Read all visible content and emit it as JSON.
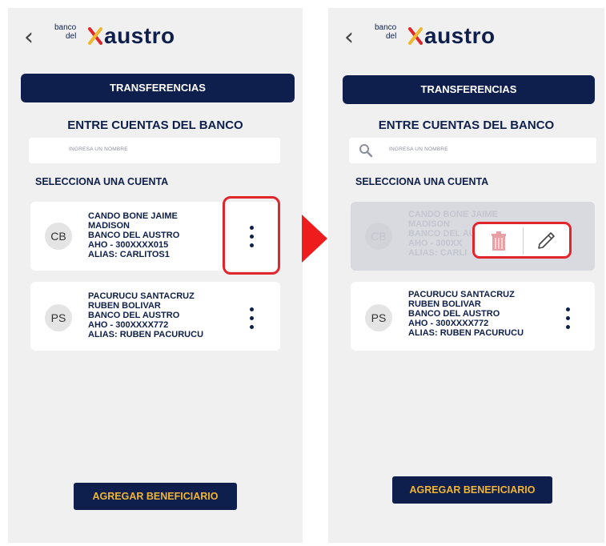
{
  "left": {
    "logo": {
      "small_top": "banco",
      "small_bottom": "del",
      "word": "austro"
    },
    "title_button": "TRANSFERENCIAS",
    "subtitle": "ENTRE CUENTAS DEL BANCO",
    "search_placeholder": "INGRESA UN NOMBRE",
    "select_heading": "SELECCIONA UNA CUENTA",
    "accounts": [
      {
        "initials": "CB",
        "lines": [
          "CANDO BONE JAIME",
          "MADISON",
          "BANCO DEL AUSTRO",
          "AHO - 300XXXX015",
          "ALIAS: CARLITOS1"
        ]
      },
      {
        "initials": "PS",
        "lines": [
          "PACURUCU SANTACRUZ",
          "RUBEN BOLIVAR",
          "BANCO DEL AUSTRO",
          "AHO - 300XXXX772",
          "ALIAS: RUBEN PACURUCU"
        ]
      }
    ],
    "add_button": "AGREGAR BENEFICIARIO"
  },
  "right": {
    "logo": {
      "small_top": "banco",
      "small_bottom": "del",
      "word": "austro"
    },
    "title_button": "TRANSFERENCIAS",
    "subtitle": "ENTRE CUENTAS DEL BANCO",
    "search_placeholder": "INGRESA UN NOMBRE",
    "select_heading": "SELECCIONA UNA CUENTA",
    "accounts": [
      {
        "initials": "CB",
        "lines": [
          "CANDO BONE JAIME",
          "MADISON",
          "BANCO DEL AU",
          "AHO - 300XX",
          "ALIAS: CARLI"
        ]
      },
      {
        "initials": "PS",
        "lines": [
          "PACURUCU SANTACRUZ",
          "RUBEN BOLIVAR",
          "BANCO DEL AUSTRO",
          "AHO - 300XXXX772",
          "ALIAS: RUBEN PACURUCU"
        ]
      }
    ],
    "add_button": "AGREGAR BENEFICIARIO"
  },
  "colors": {
    "navy": "#0e1f4e",
    "gold": "#f0b531",
    "highlight_red": "#e0262c",
    "arrow_red": "#ee1c1c",
    "background": "#f0f0f0"
  },
  "icons": [
    "back-chevron-icon",
    "logo-mark-icon",
    "search-icon",
    "kebab-menu-icon",
    "trash-icon",
    "pencil-icon",
    "arrow-right-icon"
  ]
}
